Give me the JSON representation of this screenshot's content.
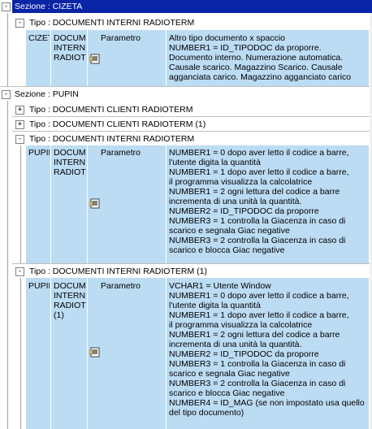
{
  "sections": [
    {
      "label": "Sezione : CIZETA",
      "toggle": "-",
      "types": [
        {
          "label": "Tipo : DOCUMENTI INTERNI RADIOTERM",
          "toggle": "-",
          "row": {
            "c1": "CIZET",
            "c2": "DOCUMI\nINTERN\nRADIOT",
            "c3": "Parametro",
            "c4": "Altro tipo documento x spaccio\nNUMBER1 = ID_TIPODOC da proporre.\nDocumento interno. Numerazione automatica.\nCausale scarico. Magazzino Scarico. Causale\nagganciata carico. Magazzino agganciato carico"
          }
        }
      ]
    },
    {
      "label": "Sezione : PUPIN",
      "toggle": "-",
      "types": [
        {
          "label": "Tipo : DOCUMENTI CLIENTI RADIOTERM",
          "toggle": "+"
        },
        {
          "label": "Tipo : DOCUMENTI CLIENTI RADIOTERM (1)",
          "toggle": "+"
        },
        {
          "label": "Tipo : DOCUMENTI INTERNI RADIOTERM",
          "toggle": "-",
          "row": {
            "c1": "PUPIN",
            "c2": "DOCUMI\nINTERN\nRADIOT",
            "c3": "Parametro",
            "c4": "NUMBER1 = 0 dopo aver letto il codice a barre,\nl'utente digita la quantità\nNUMBER1 = 1 dopo aver letto il codice a barre,\nil programma visualizza la calcolatrice\nNUMBER1 = 2 ogni lettura del codice a barre\nincrementa di una unità la quantità.\nNUMBER2 = ID_TIPODOC da proporre\nNUMBER3 = 1 controlla la Giacenza in caso di\nscarico e segnala Giac negative\nNUMBER3 = 2 controlla la Giacenza in caso di\nscarico e blocca  Giac negative"
          }
        },
        {
          "label": "Tipo : DOCUMENTI INTERNI RADIOTERM (1)",
          "toggle": "-",
          "row": {
            "c1": "PUPIN",
            "c2": "DOCUMI\nINTERN\nRADIOT\n(1)",
            "c3": "Parametro",
            "c4": "VCHAR1 = Utente Window\nNUMBER1 = 0 dopo aver letto il codice a barre,\nl'utente digita la quantità\nNUMBER1 = 1 dopo aver letto il codice a barre,\nil programma visualizza la calcolatrice\nNUMBER1 = 2 ogni lettura del codice a barre\nincrementa di una unità la quantità.\nNUMBER2 = ID_TIPODOC da proporre\nNUMBER3 = 1 controlla la Giacenza in caso di\nscarico e segnala Giac negative\nNUMBER3 = 2 controlla la Giacenza in caso di\nscarico e blocca  Giac negative\nNUMBER4 = ID_MAG (se non impostato usa quello\ndel tipo documento)"
          }
        }
      ]
    }
  ],
  "icons": {
    "doc": "document-lines-icon",
    "toggle_collapse": "minus-box-icon",
    "toggle_expand": "plus-box-icon"
  },
  "colors": {
    "selected": "#0a24a6",
    "row_bg": "#bcdcf4"
  }
}
